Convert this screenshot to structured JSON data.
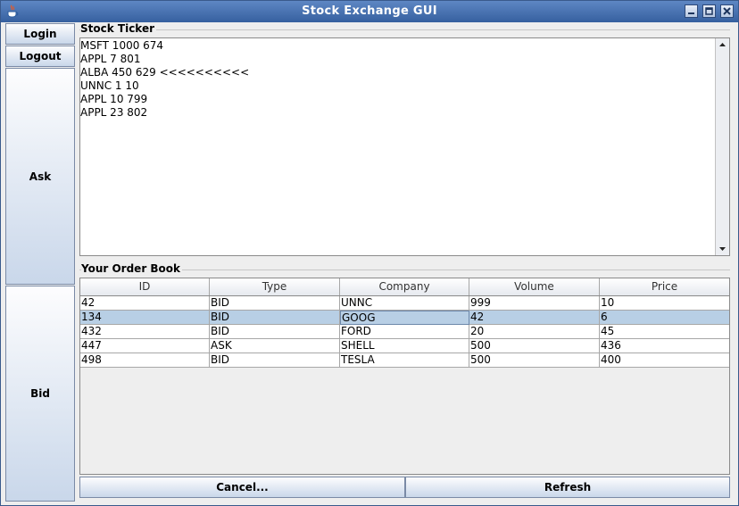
{
  "window": {
    "title": "Stock Exchange GUI"
  },
  "left_buttons": {
    "login": "Login",
    "logout": "Logout",
    "ask": "Ask",
    "bid": "Bid"
  },
  "ticker": {
    "label": "Stock Ticker",
    "lines": [
      "MSFT 1000 674",
      "APPL 7 801",
      "ALBA 450 629 <<<<<<<<<<",
      "UNNC 1 10",
      "APPL 10 799",
      "APPL 23 802"
    ]
  },
  "order_book": {
    "label": "Your Order Book",
    "columns": [
      "ID",
      "Type",
      "Company",
      "Volume",
      "Price"
    ],
    "rows": [
      [
        "42",
        "BID",
        "UNNC",
        "999",
        "10"
      ],
      [
        "134",
        "BID",
        "GOOG",
        "42",
        "6"
      ],
      [
        "432",
        "BID",
        "FORD",
        "20",
        "45"
      ],
      [
        "447",
        "ASK",
        "SHELL",
        "500",
        "436"
      ],
      [
        "498",
        "BID",
        "TESLA",
        "500",
        "400"
      ]
    ],
    "selected_row": 1
  },
  "bottom_buttons": {
    "cancel": "Cancel...",
    "refresh": "Refresh"
  },
  "colors": {
    "titlebar": "#36609f",
    "selection": "#b8cfe5",
    "button_top": "#fdfdfe",
    "button_bottom": "#c9d7ea"
  },
  "icons": {
    "app": "java-cup-icon",
    "minimize": "minimize-icon",
    "maximize": "maximize-icon",
    "close": "close-icon"
  }
}
